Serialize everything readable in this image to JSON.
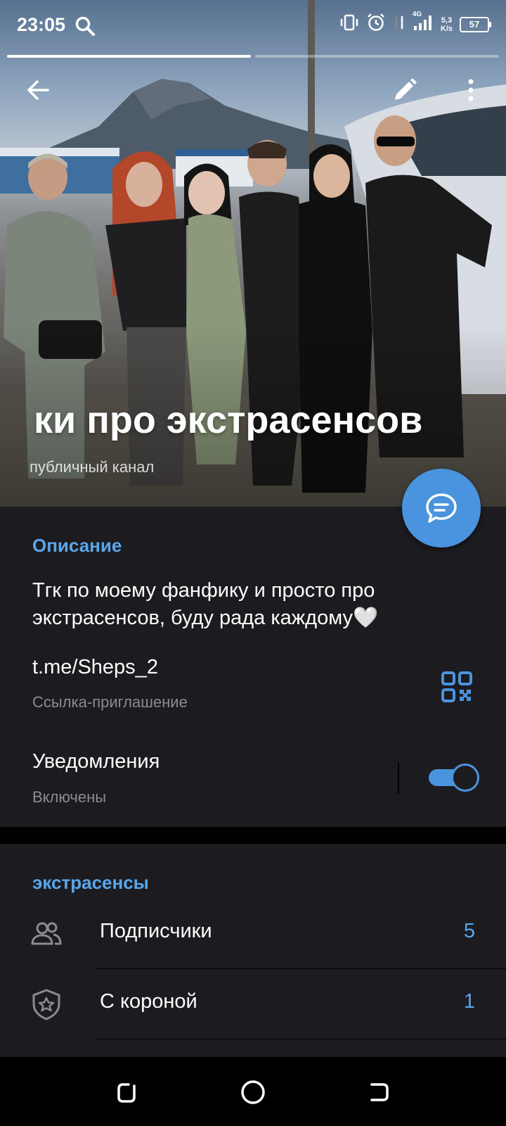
{
  "status_bar": {
    "time": "23:05",
    "network": "4G",
    "speed_value": "5,3",
    "speed_unit": "K/s",
    "battery": "57"
  },
  "stories": {
    "progress": [
      1.0,
      0.0
    ]
  },
  "channel": {
    "title": "ки про экстрасенсов",
    "subtitle": "публичный канал"
  },
  "info": {
    "description_header": "Описание",
    "description": "Тгк по моему фанфику и просто про экстрасенсов, буду рада каждому🤍",
    "link": "t.me/Sheps_2",
    "link_label": "Ссылка-приглашение",
    "notifications_title": "Уведомления",
    "notifications_status": "Включены",
    "notifications_enabled": true
  },
  "members": {
    "header": "экстрасенсы",
    "rows": [
      {
        "label": "Подписчики",
        "count": "5",
        "icon": "people-icon"
      },
      {
        "label": "С короной",
        "count": "1",
        "icon": "crown-shield-icon"
      }
    ]
  },
  "colors": {
    "accent": "#4a94df",
    "link_accent": "#5aa6ea",
    "background": "#1c1b1f",
    "secondary_text": "#8c8b90"
  }
}
